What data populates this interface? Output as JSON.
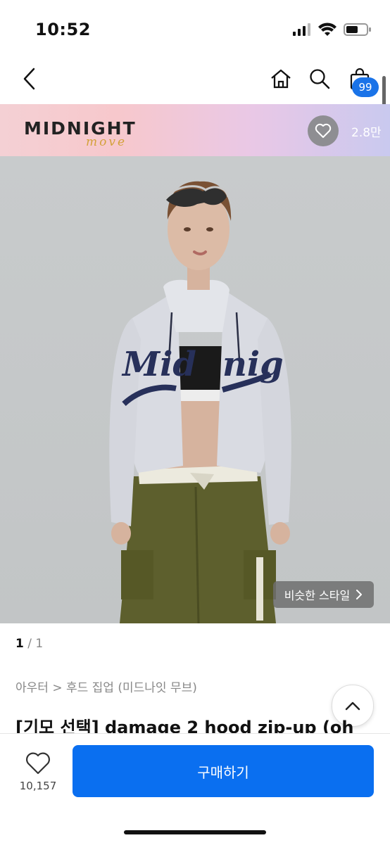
{
  "status": {
    "time": "10:52"
  },
  "nav": {
    "cart_badge": "99"
  },
  "brand": {
    "logo": "MIDNIGHT",
    "sub": "move",
    "like_count": "2.8만"
  },
  "image": {
    "similar_style": "비슷한 스타일",
    "jacket_text_left": "Mid",
    "jacket_text_right": "nig"
  },
  "pagination": {
    "current": "1",
    "separator": " / ",
    "total": "1"
  },
  "product": {
    "breadcrumb": "아우터 > 후드 집업 (미드나잇 무브)",
    "title": "[기모 선택] damage 2 hood zip-up (oh"
  },
  "footer": {
    "like_count": "10,157",
    "buy_label": "구매하기"
  },
  "colors": {
    "accent": "#0a6ff0",
    "badge": "#1a73e8"
  }
}
